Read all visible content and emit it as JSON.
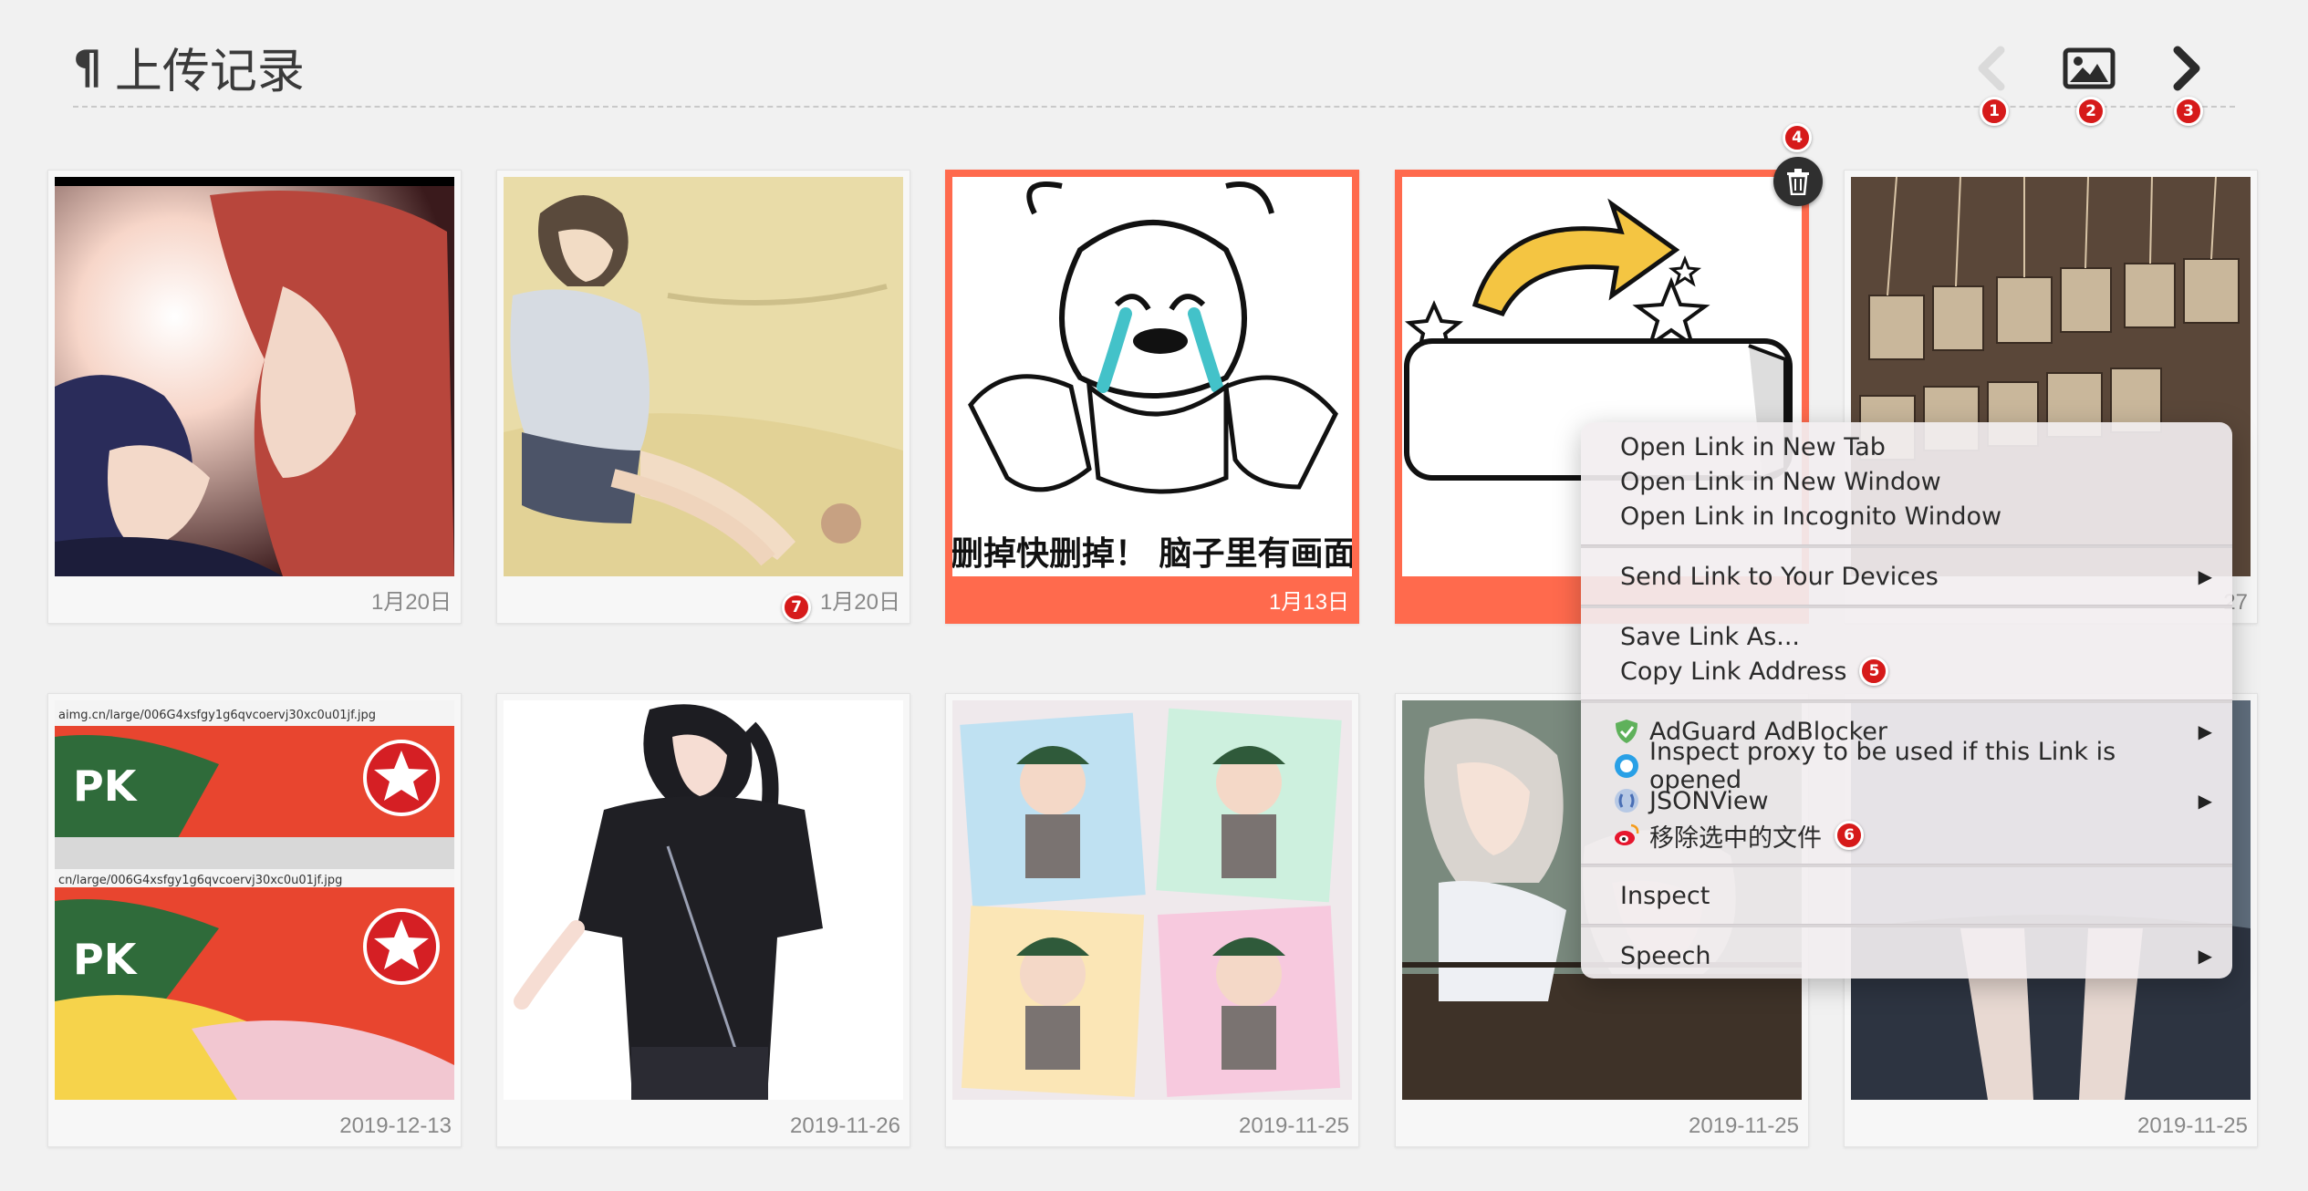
{
  "header": {
    "pilcrow": "¶",
    "title": "上传记录"
  },
  "nav": {
    "prev_badge": "1",
    "image_badge": "2",
    "next_badge": "3"
  },
  "trash_badge": "4",
  "cards": [
    {
      "date": "1月20日",
      "selected": false,
      "badge": ""
    },
    {
      "date": "1月20日",
      "selected": false,
      "badge": "7"
    },
    {
      "date": "1月13日",
      "selected": true,
      "badge": ""
    },
    {
      "date": "",
      "selected": true,
      "badge": ""
    },
    {
      "date": "27",
      "selected": false,
      "badge": ""
    },
    {
      "date": "2019-12-13",
      "selected": false,
      "badge": ""
    },
    {
      "date": "2019-11-26",
      "selected": false,
      "badge": ""
    },
    {
      "date": "2019-11-25",
      "selected": false,
      "badge": ""
    },
    {
      "date": "2019-11-25",
      "selected": false,
      "badge": ""
    },
    {
      "date": "2019-11-25",
      "selected": false,
      "badge": ""
    }
  ],
  "meme_caption": "删掉快删掉！ 脑子里有画面",
  "screenshot_urls": {
    "top": "aimg.cn/large/006G4xsfgy1g6qvcoervj30xc0u01jf.jpg",
    "bottom": "cn/large/006G4xsfgy1g6qvcoervj30xc0u01jf.jpg"
  },
  "context_menu": {
    "open_new_tab": "Open Link in New Tab",
    "open_new_window": "Open Link in New Window",
    "open_incognito": "Open Link in Incognito Window",
    "send_to_devices": "Send Link to Your Devices",
    "save_link_as": "Save Link As...",
    "copy_link_address": "Copy Link Address",
    "copy_badge": "5",
    "adguard": "AdGuard AdBlocker",
    "inspect_proxy": "Inspect proxy to be used if this Link is opened",
    "jsonview": "JSONView",
    "remove_selected": "移除选中的文件",
    "remove_badge": "6",
    "inspect": "Inspect",
    "speech": "Speech",
    "submenu_arrow": "▶"
  },
  "colors": {
    "selected": "#ff6a4d",
    "badge": "#d61a1a",
    "background": "#f1f1f1"
  }
}
